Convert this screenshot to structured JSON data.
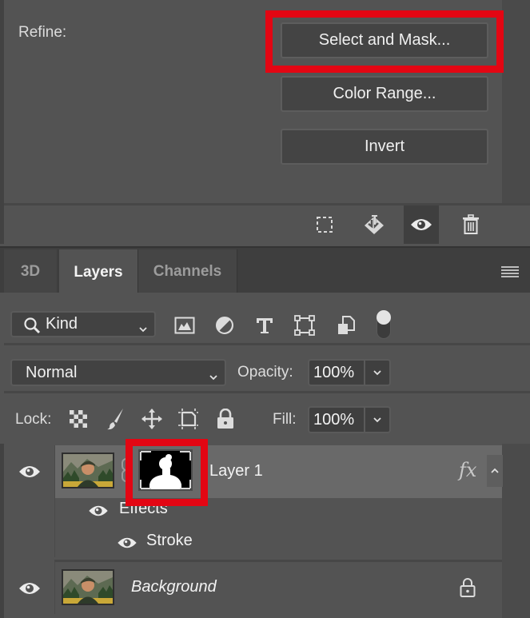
{
  "properties_panel": {
    "refine_label": "Refine:",
    "buttons": {
      "select_and_mask": "Select and Mask...",
      "color_range": "Color Range...",
      "invert": "Invert"
    },
    "footer_icons": [
      "load-selection-icon",
      "apply-mask-icon",
      "visibility-eye-icon",
      "trash-icon"
    ],
    "active_footer_icon": "visibility-eye-icon"
  },
  "tabs": {
    "items": [
      {
        "label": "3D",
        "active": false
      },
      {
        "label": "Layers",
        "active": true
      },
      {
        "label": "Channels",
        "active": false
      }
    ]
  },
  "filter_row": {
    "kind_select": "Kind",
    "filter_icons": [
      "pixel-layer-filter-icon",
      "adjustment-layer-filter-icon",
      "type-layer-filter-icon",
      "shape-layer-filter-icon",
      "smart-object-filter-icon"
    ],
    "filter_toggle_on": true
  },
  "blend_row": {
    "mode": "Normal",
    "opacity_label": "Opacity:",
    "opacity_value": "100%"
  },
  "lock_row": {
    "lock_label": "Lock:",
    "lock_icons": [
      "lock-transparent-pixels-icon",
      "lock-image-pixels-icon",
      "lock-position-icon",
      "lock-artboard-icon",
      "lock-all-icon"
    ],
    "fill_label": "Fill:",
    "fill_value": "100%"
  },
  "layers": [
    {
      "name": "Layer 1",
      "visible": true,
      "selected": true,
      "has_mask": true,
      "fx_badge": "fx",
      "effects_label": "Effects",
      "effects": [
        {
          "name": "Stroke",
          "visible": true
        }
      ]
    },
    {
      "name": "Background",
      "visible": true,
      "locked": true
    }
  ],
  "colors": {
    "highlight": "#e30613",
    "panel_bg": "#535353",
    "selected_layer_bg": "#696969"
  }
}
